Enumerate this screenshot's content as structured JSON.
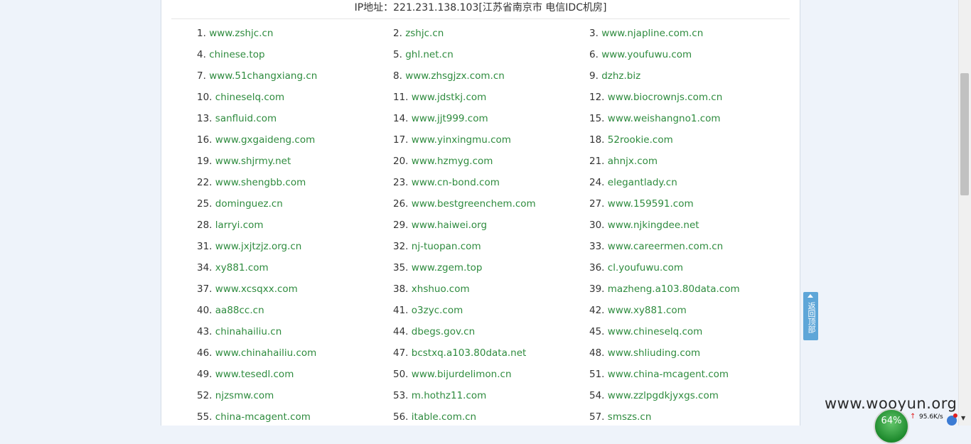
{
  "header": {
    "ip_line": "IP地址：221.231.138.103[江苏省南京市 电信IDC机房]"
  },
  "domains": [
    {
      "n": "1.",
      "d": "www.zshjc.cn"
    },
    {
      "n": "2.",
      "d": "zshjc.cn"
    },
    {
      "n": "3.",
      "d": "www.njapline.com.cn"
    },
    {
      "n": "4.",
      "d": "chinese.top"
    },
    {
      "n": "5.",
      "d": "ghl.net.cn"
    },
    {
      "n": "6.",
      "d": "www.youfuwu.com"
    },
    {
      "n": "7.",
      "d": "www.51changxiang.cn"
    },
    {
      "n": "8.",
      "d": "www.zhsgjzx.com.cn"
    },
    {
      "n": "9.",
      "d": "dzhz.biz"
    },
    {
      "n": "10.",
      "d": "chineselq.com"
    },
    {
      "n": "11.",
      "d": "www.jdstkj.com"
    },
    {
      "n": "12.",
      "d": "www.biocrownjs.com.cn"
    },
    {
      "n": "13.",
      "d": "sanfluid.com"
    },
    {
      "n": "14.",
      "d": "www.jjt999.com"
    },
    {
      "n": "15.",
      "d": "www.weishangno1.com"
    },
    {
      "n": "16.",
      "d": "www.gxgaideng.com"
    },
    {
      "n": "17.",
      "d": "www.yinxingmu.com"
    },
    {
      "n": "18.",
      "d": "52rookie.com"
    },
    {
      "n": "19.",
      "d": "www.shjrmy.net"
    },
    {
      "n": "20.",
      "d": "www.hzmyg.com"
    },
    {
      "n": "21.",
      "d": "ahnjx.com"
    },
    {
      "n": "22.",
      "d": "www.shengbb.com"
    },
    {
      "n": "23.",
      "d": "www.cn-bond.com"
    },
    {
      "n": "24.",
      "d": "elegantlady.cn"
    },
    {
      "n": "25.",
      "d": "dominguez.cn"
    },
    {
      "n": "26.",
      "d": "www.bestgreenchem.com"
    },
    {
      "n": "27.",
      "d": "www.159591.com"
    },
    {
      "n": "28.",
      "d": "larryi.com"
    },
    {
      "n": "29.",
      "d": "www.haiwei.org"
    },
    {
      "n": "30.",
      "d": "www.njkingdee.net"
    },
    {
      "n": "31.",
      "d": "www.jxjtzjz.org.cn"
    },
    {
      "n": "32.",
      "d": "nj-tuopan.com"
    },
    {
      "n": "33.",
      "d": "www.careermen.com.cn"
    },
    {
      "n": "34.",
      "d": "xy881.com"
    },
    {
      "n": "35.",
      "d": "www.zgem.top"
    },
    {
      "n": "36.",
      "d": "cl.youfuwu.com"
    },
    {
      "n": "37.",
      "d": "www.xcsqxx.com"
    },
    {
      "n": "38.",
      "d": "xhshuo.com"
    },
    {
      "n": "39.",
      "d": "mazheng.a103.80data.com"
    },
    {
      "n": "40.",
      "d": "aa88cc.cn"
    },
    {
      "n": "41.",
      "d": "o3zyc.com"
    },
    {
      "n": "42.",
      "d": "www.xy881.com"
    },
    {
      "n": "43.",
      "d": "chinahailiu.cn"
    },
    {
      "n": "44.",
      "d": "dbegs.gov.cn"
    },
    {
      "n": "45.",
      "d": "www.chineselq.com"
    },
    {
      "n": "46.",
      "d": "www.chinahailiu.com"
    },
    {
      "n": "47.",
      "d": "bcstxq.a103.80data.net"
    },
    {
      "n": "48.",
      "d": "www.shliuding.com"
    },
    {
      "n": "49.",
      "d": "www.tesedl.com"
    },
    {
      "n": "50.",
      "d": "www.bijurdelimon.cn"
    },
    {
      "n": "51.",
      "d": "www.china-mcagent.com"
    },
    {
      "n": "52.",
      "d": "njzsmw.com"
    },
    {
      "n": "53.",
      "d": "m.hothz11.com"
    },
    {
      "n": "54.",
      "d": "www.zzlpgdkjyxgs.com"
    },
    {
      "n": "55.",
      "d": "china-mcagent.com"
    },
    {
      "n": "56.",
      "d": "itable.com.cn"
    },
    {
      "n": "57.",
      "d": "smszs.cn"
    }
  ],
  "back_to_top": {
    "label": "返回顶部"
  },
  "watermark": "www.wooyun.org",
  "net_widget": {
    "percent": "64%",
    "up_arrow": "↑",
    "speed": "95.6K/s",
    "caret": "▼"
  },
  "colors": {
    "link": "#2e8b3e",
    "page_bg": "#eef3fa",
    "back_to_top_bg": "#5ea6d8",
    "widget_green": "#1e8a2d"
  }
}
